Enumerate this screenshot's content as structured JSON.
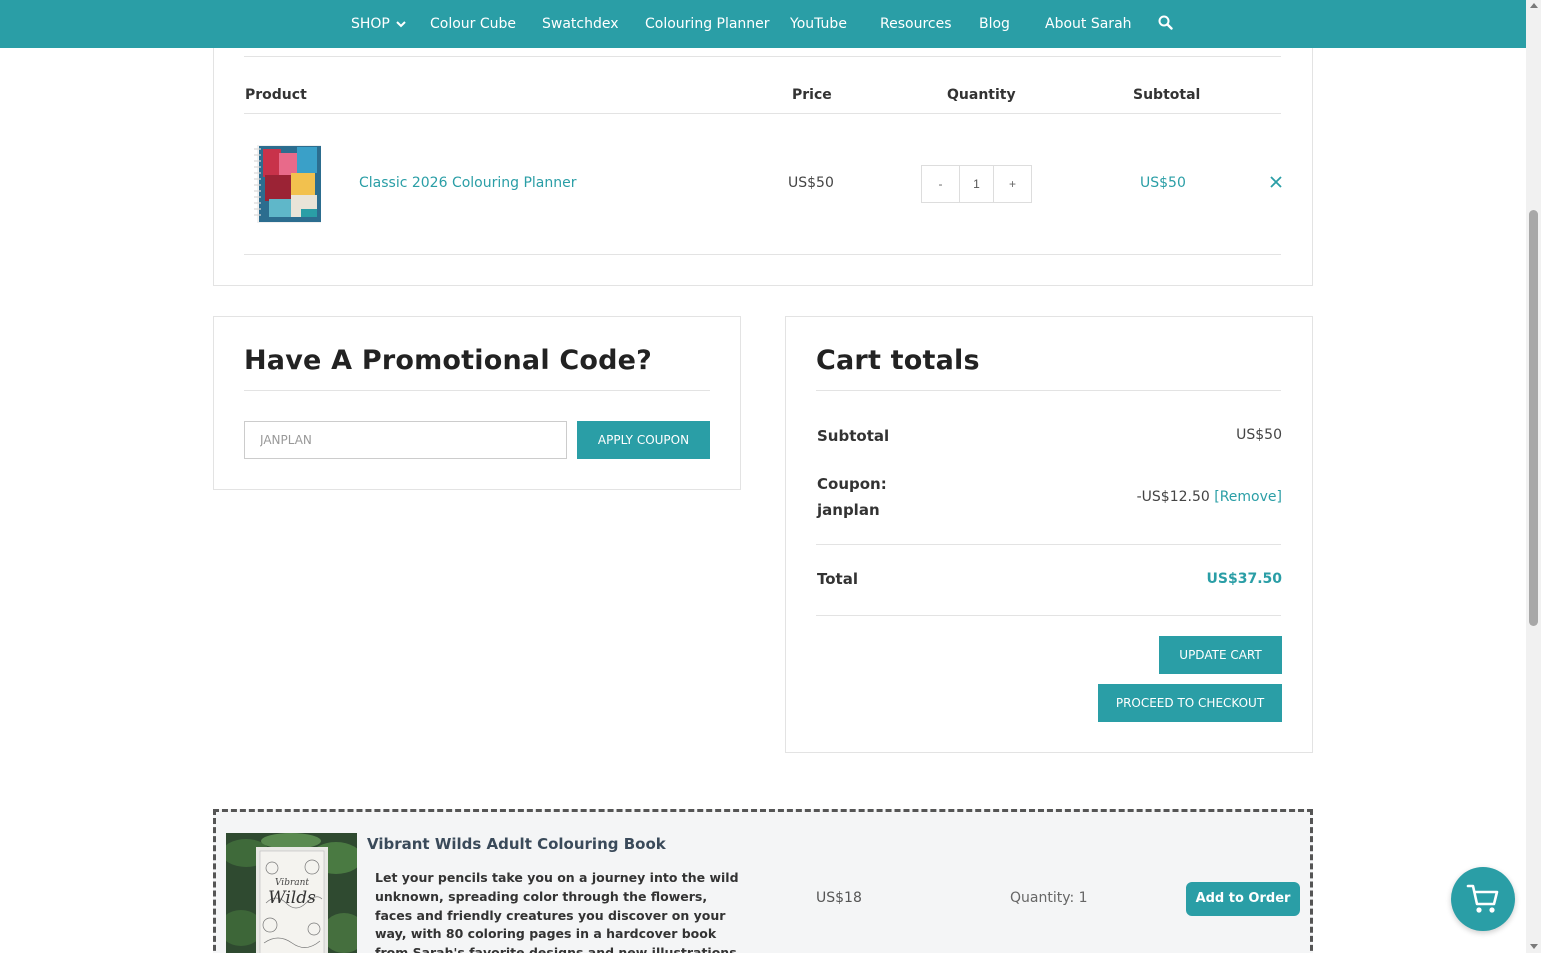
{
  "nav": {
    "items": [
      "SHOP",
      "Colour Cube",
      "Swatchdex",
      "Colouring Planner",
      "YouTube",
      "Resources",
      "Blog",
      "About Sarah"
    ],
    "icons": {
      "shop_dropdown": "chevron-down-icon",
      "search": "search-icon"
    },
    "background": "#2a9ea6"
  },
  "cart_table": {
    "headers": {
      "product": "Product",
      "price": "Price",
      "quantity": "Quantity",
      "subtotal": "Subtotal"
    },
    "rows": [
      {
        "product_name": "Classic 2026 Colouring Planner",
        "price": "US$50",
        "quantity": "1",
        "qty_minus": "-",
        "qty_plus": "+",
        "subtotal": "US$50",
        "remove_icon": "close-icon"
      }
    ]
  },
  "promo": {
    "heading": "Have A Promotional Code?",
    "input_value": "JANPLAN",
    "apply_label": "APPLY COUPON"
  },
  "totals": {
    "heading": "Cart totals",
    "subtotal_label": "Subtotal",
    "subtotal_value": "US$50",
    "coupon_label_line1": "Coupon:",
    "coupon_label_line2": "janplan",
    "coupon_value": "-US$12.50",
    "coupon_remove": "[Remove]",
    "total_label": "Total",
    "total_value": "US$37.50",
    "update_cart": "UPDATE CART",
    "checkout": "PROCEED TO CHECKOUT"
  },
  "upsell": {
    "title": "Vibrant Wilds Adult Colouring Book",
    "description": "Let your pencils take you on a journey into the wild unknown, spreading color through the flowers, faces and friendly creatures you discover on your way, with 80 coloring pages in a hardcover book from Sarah's favorite designs and new illustrations.",
    "price": "US$18",
    "quantity": "Quantity: 1",
    "button": "Add to Order"
  },
  "floating_cart": {
    "icon": "cart-icon"
  },
  "colors": {
    "accent": "#2a9ea6",
    "text": "#333333",
    "border": "#e3e3e3"
  }
}
